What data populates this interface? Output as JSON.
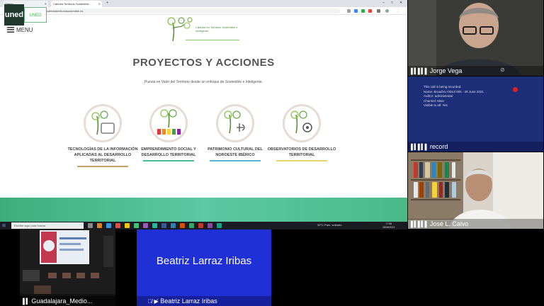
{
  "browser": {
    "tabs": [
      {
        "label": "Webex"
      },
      {
        "label": "Cátedra Territorio Sostenible..."
      }
    ],
    "url": "catedraterritoriosostenible.es"
  },
  "overlay": {
    "logo_main": "uned",
    "logo_secondary": "UNED"
  },
  "website": {
    "menu_label": "MENU",
    "logo_text": "Cátedra en Territorio Sostenible e Inteligente",
    "title": "PROYECTOS Y ACCIONES",
    "subtitle": "Puesta en Valor del Territorio desde un enfoque de Sostenible e Inteligente.",
    "cards": [
      {
        "label": "TECNOLOGÍAS DE LA INFORMACIÓN APLICADAS AL DESARROLLO TERRITORIAL",
        "bar_color": "#c9a064"
      },
      {
        "label": "EMPRENDIMIENTO SOCIAL Y DESARROLLO TERRITORIAL",
        "bar_color": "#4cbb9c"
      },
      {
        "label": "PATRIMONIO CULTURAL DEL NOROESTE IBÉRICO",
        "bar_color": "#58b7d8"
      },
      {
        "label": "OBSERVATORIOS DE DESARROLLO TERRITORIAL",
        "bar_color": "#e7d56a"
      }
    ]
  },
  "taskbar": {
    "search_placeholder": "Escribe aquí para buscar",
    "tray": "30°C  Parc. soleado",
    "time": "17:56",
    "date": "28/06/2021"
  },
  "participants": {
    "jorge": {
      "name": "Jorge Vega"
    },
    "record": {
      "name": "record",
      "info_lines": [
        "This call is being recorded.",
        "Name: BroadVu Obsol 005 - 28 June 2021",
        "Author: administrator",
        "Channel: Main",
        "Visible to all: Yes"
      ]
    },
    "jose": {
      "name": "José L. Calvo"
    },
    "guadalajara": {
      "name": "Guadalajara_Medio..."
    },
    "beatriz": {
      "name": "Beatriz Larraz Iribas",
      "display_name": "Beatriz Larraz Iribas"
    }
  }
}
